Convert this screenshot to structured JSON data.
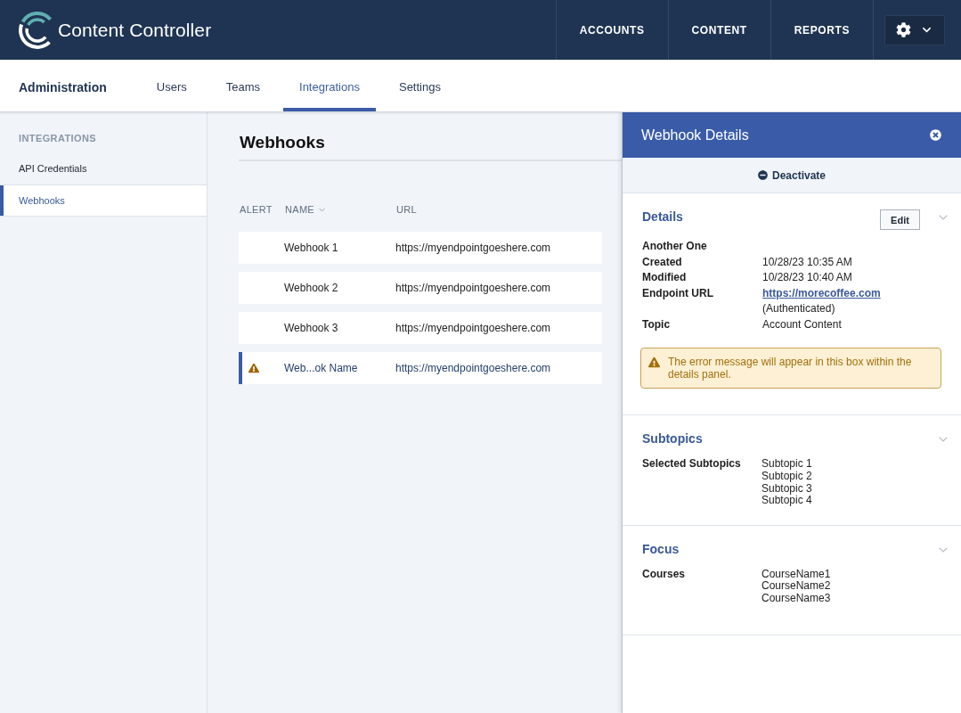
{
  "header": {
    "brand": "Content Controller",
    "nav": [
      {
        "label": "ACCOUNTS"
      },
      {
        "label": "CONTENT"
      },
      {
        "label": "REPORTS"
      }
    ]
  },
  "subnav": {
    "title": "Administration",
    "tabs": [
      {
        "label": "Users",
        "selected": false
      },
      {
        "label": "Teams",
        "selected": false
      },
      {
        "label": "Integrations",
        "selected": true
      },
      {
        "label": "Settings",
        "selected": false
      }
    ]
  },
  "sidebar": {
    "heading": "INTEGRATIONS",
    "items": [
      {
        "label": "API Credentials",
        "selected": false
      },
      {
        "label": "Webhooks",
        "selected": true
      }
    ]
  },
  "main": {
    "title": "Webhooks",
    "table": {
      "columns": [
        {
          "label": "ALERT",
          "sorted": false
        },
        {
          "label": "NAME",
          "sorted": true
        },
        {
          "label": "URL",
          "sorted": false
        }
      ],
      "rows": [
        {
          "alert": false,
          "name": "Webhook 1",
          "url": "https://myendpointgoeshere.com",
          "selected": false
        },
        {
          "alert": false,
          "name": "Webhook 2",
          "url": "https://myendpointgoeshere.com",
          "selected": false
        },
        {
          "alert": false,
          "name": "Webhook 3",
          "url": "https://myendpointgoeshere.com",
          "selected": false
        },
        {
          "alert": true,
          "name": "Web...ok Name",
          "url": "https://myendpointgoeshere.com",
          "selected": true
        }
      ]
    }
  },
  "details_panel": {
    "title": "Webhook Details",
    "deactivate_label": "Deactivate",
    "sections": [
      {
        "kind": "details",
        "title": "Details",
        "edit_label": "Edit",
        "name": "Another One",
        "fields": [
          {
            "label": "Created",
            "kind": "text",
            "value": "10/28/23 10:35 AM"
          },
          {
            "label": "Modified",
            "kind": "text",
            "value": "10/28/23 10:40 AM"
          },
          {
            "label": "Endpoint URL",
            "kind": "link",
            "value": "https://morecoffee.com",
            "note": "(Authenticated)"
          },
          {
            "label": "Topic",
            "kind": "text",
            "value": "Account Content"
          }
        ],
        "error": "The error message will appear in this box within the details panel."
      },
      {
        "kind": "list",
        "title": "Subtopics",
        "label": "Selected Subtopics",
        "values": [
          "Subtopic 1",
          "Subtopic 2",
          "Subtopic 3",
          "Subtopic 4"
        ]
      },
      {
        "kind": "list",
        "title": "Focus",
        "label": "Courses",
        "values": [
          "CourseName1",
          "CourseName2",
          "CourseName3"
        ]
      }
    ]
  }
}
